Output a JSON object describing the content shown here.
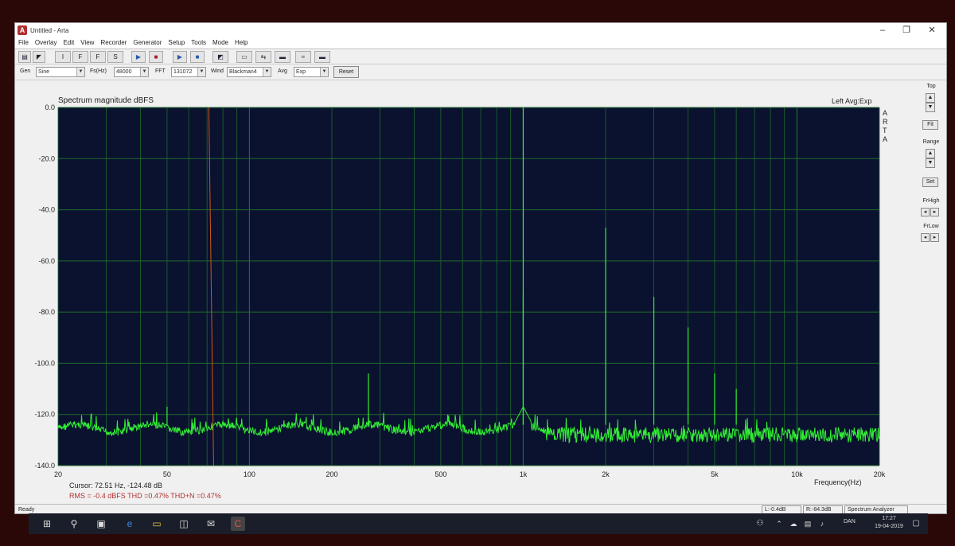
{
  "window": {
    "title": "Untitled - Arta",
    "minimize_icon": "minimize-icon",
    "maximize_icon": "restore-icon",
    "close_icon": "close-icon"
  },
  "menu": [
    "File",
    "Overlay",
    "Edit",
    "View",
    "Recorder",
    "Generator",
    "Setup",
    "Tools",
    "Mode",
    "Help"
  ],
  "toolbar1": {
    "buttons": [
      {
        "label": "",
        "icon": "open-icon"
      },
      {
        "label": "",
        "icon": "cursor-icon"
      },
      {
        "label": "I",
        "icon": "impulse-mode-icon"
      },
      {
        "label": "F",
        "icon": "fr2-mode-icon"
      },
      {
        "label": "F",
        "icon": "fr1-mode-icon"
      },
      {
        "label": "S",
        "icon": "spectrum-mode-icon"
      },
      {
        "label": "▶",
        "icon": "play-icon"
      },
      {
        "label": "■",
        "icon": "stop-icon"
      },
      {
        "label": "▶",
        "icon": "play2-icon"
      },
      {
        "label": "■",
        "icon": "stop2-icon"
      }
    ]
  },
  "toolbar2": {
    "gen_label": "Gen",
    "gen_value": "Sine",
    "fs_label": "Fs(Hz)",
    "fs_value": "48000",
    "fft_label": "FFT",
    "fft_value": "131072",
    "wind_label": "Wind",
    "wind_value": "Blackman4",
    "avg_label": "Avg",
    "avg_value": "Exp",
    "reset_label": "Reset"
  },
  "plot": {
    "title": "Spectrum magnitude dBFS",
    "info": "Left  Avg:Exp",
    "vertical_text": [
      "A",
      "R",
      "T",
      "A"
    ],
    "cursor_readout": "Cursor: 72.51 Hz, -124.48 dB",
    "rms_readout": "RMS =   -0.4 dBFS   THD =0.47%   THD+N =0.47%",
    "freq_axis_label": "Frequency(Hz)"
  },
  "side_panel": {
    "top_label": "Top",
    "fit_label": "Fit",
    "range_label": "Range",
    "set_label": "Set",
    "frhigh_label": "FrHigh",
    "frlow_label": "FrLow"
  },
  "status": {
    "ready": "Ready",
    "left_level": "L:-0.4dB",
    "right_level": "R:-84.3dB",
    "mode": "Spectrum Analyzer"
  },
  "taskbar": {
    "time": "17:27",
    "date": "19-04-2019",
    "lang": "DAN"
  },
  "chart_data": {
    "type": "line",
    "title": "Spectrum magnitude dBFS",
    "xlabel": "Frequency(Hz)",
    "ylabel": "",
    "xscale": "log",
    "xlim": [
      20,
      20000
    ],
    "ylim": [
      -140,
      0
    ],
    "yticks": [
      0,
      -20,
      -40,
      -60,
      -80,
      -100,
      -120,
      -140
    ],
    "ytick_labels": [
      "0.0",
      "-20.0",
      "-40.0",
      "-60.0",
      "-80.0",
      "-100.0",
      "-120.0",
      "-140.0"
    ],
    "xticks": [
      20,
      50,
      100,
      200,
      500,
      1000,
      2000,
      5000,
      10000,
      20000
    ],
    "xtick_labels": [
      "20",
      "50",
      "100",
      "200",
      "500",
      "1k",
      "2k",
      "5k",
      "10k",
      "20k"
    ],
    "grid": true,
    "colors": {
      "background": "#0a1230",
      "grid": "#1f6b2a",
      "trace": "#33ee33",
      "cursor": "#cc5a10"
    },
    "cursor_x": 72.51,
    "noise_floor": -124,
    "peaks": [
      {
        "x": 272,
        "y": -104
      },
      {
        "x": 1000,
        "y": 0
      },
      {
        "x": 1000,
        "y": -73
      },
      {
        "x": 2000,
        "y": -47
      },
      {
        "x": 3000,
        "y": -74
      },
      {
        "x": 4000,
        "y": -86
      },
      {
        "x": 5000,
        "y": -104
      },
      {
        "x": 6000,
        "y": -110
      },
      {
        "x": 50,
        "y": -117
      }
    ]
  }
}
